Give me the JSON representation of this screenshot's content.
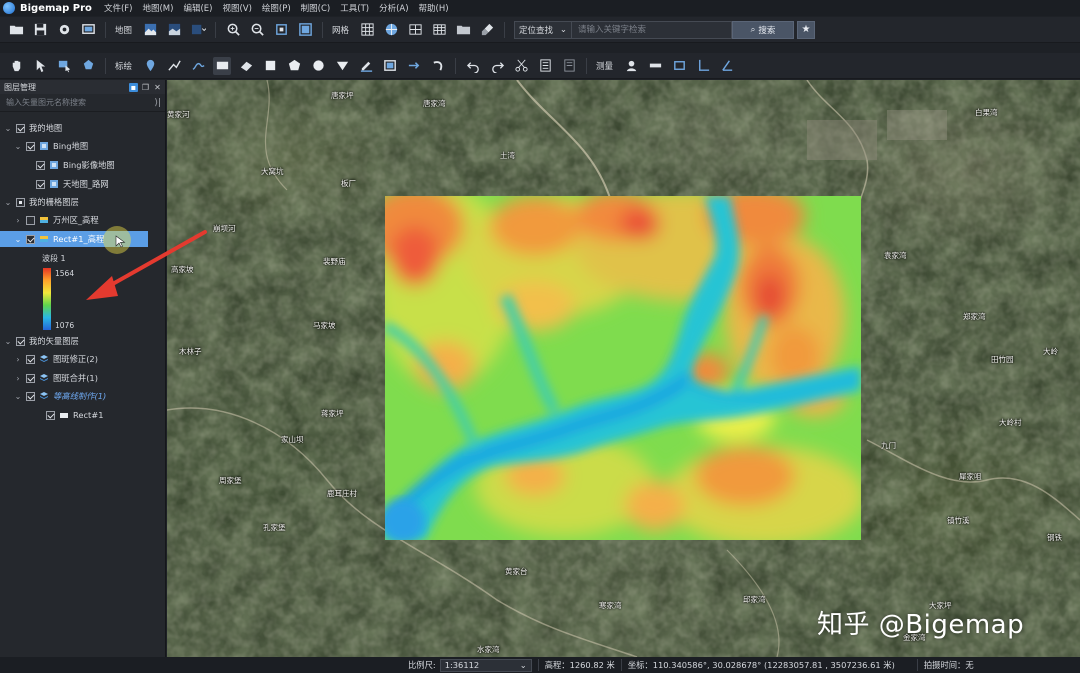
{
  "app": {
    "title": "Bigemap Pro"
  },
  "menu": [
    "文件(F)",
    "地图(M)",
    "编辑(E)",
    "视图(V)",
    "绘图(P)",
    "制图(C)",
    "工具(T)",
    "分析(A)",
    "帮助(H)"
  ],
  "toolbar1": {
    "map_label": "地图",
    "grid_label": "网格",
    "search_mode": "定位查找",
    "search_placeholder": "请输入关键字检索",
    "search_button": "搜索"
  },
  "toolbar2": {
    "annotate_label": "标绘",
    "measure_label": "测量"
  },
  "layer_panel": {
    "title": "图层管理",
    "search_placeholder": "输入矢量图元名称搜索",
    "items": [
      {
        "label": "我的地图"
      },
      {
        "label": "Bing地图"
      },
      {
        "label": "Bing影像地图"
      },
      {
        "label": "天地图_路网"
      },
      {
        "label": "我的栅格图层"
      },
      {
        "label": "万州区_高程"
      },
      {
        "label": "Rect#1_高程"
      },
      {
        "label": "我的矢量图层"
      },
      {
        "label": "图斑修正(2)"
      },
      {
        "label": "图斑合并(1)"
      },
      {
        "label": "等高线制作(1)"
      },
      {
        "label": "Rect#1"
      }
    ],
    "legend": {
      "band": "波段 1",
      "max": "1564",
      "min": "1076"
    }
  },
  "map_labels": [
    "唐家坪",
    "唐家湾",
    "黄家河",
    "土湾",
    "大窝坑",
    "板厂",
    "崩坝河",
    "裴野庙",
    "高家坡",
    "马家坡",
    "木林子",
    "蒋家坪",
    "家山坝",
    "周家堡",
    "鹿耳庄村",
    "孔家堡",
    "黄家台",
    "寒家湾",
    "邱家湾",
    "水家湾",
    "白果湾",
    "袁家湾",
    "郑家湾",
    "田竹园",
    "九门",
    "大岭村",
    "犀家咀",
    "镇竹溪",
    "大家坪",
    "钢铁",
    "金家湾",
    "大岭"
  ],
  "watermark": "知乎 @Bigemap",
  "statusbar": {
    "scale_label": "比例尺:",
    "scale_value": "1:36112",
    "elevation": "高程：1260.82 米",
    "coords": "坐标：110.340586°, 30.028678°  (12283057.81 , 3507236.61 米)",
    "capture_time": "拍摄时间：无"
  }
}
